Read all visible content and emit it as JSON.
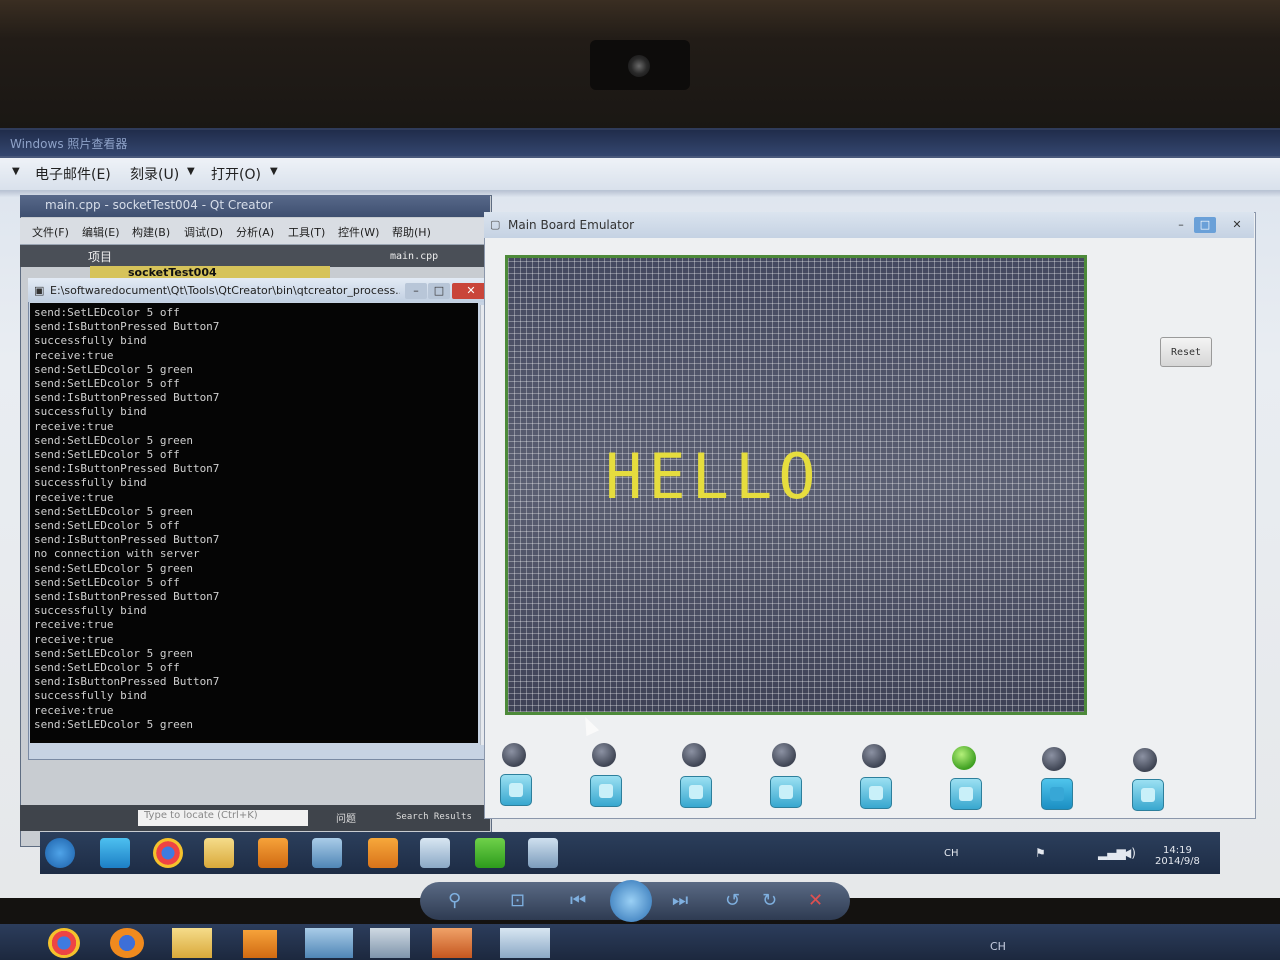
{
  "viewer": {
    "title": "Windows 照片查看器",
    "menu": [
      "电子邮件(E)",
      "刻录(U)",
      "打开(O)"
    ]
  },
  "qtcreator": {
    "title": "main.cpp - socketTest004 - Qt Creator",
    "menu": [
      "文件(F)",
      "编辑(E)",
      "构建(B)",
      "调试(D)",
      "分析(A)",
      "工具(T)",
      "控件(W)",
      "帮助(H)"
    ],
    "project_label": "项目",
    "open_file": "main.cpp",
    "tree_item": "socketTest004",
    "locate_placeholder": "Type to locate (Ctrl+K)",
    "tab_issues": "问题",
    "tab_search": "Search Results"
  },
  "console": {
    "title": "E:\\softwaredocument\\Qt\\Tools\\QtCreator\\bin\\qtcreator_process...",
    "lines": [
      "send:SetLEDcolor 5 off",
      "send:IsButtonPressed Button7",
      "successfully bind",
      "receive:true",
      "send:SetLEDcolor 5 green",
      "send:SetLEDcolor 5 off",
      "send:IsButtonPressed Button7",
      "successfully bind",
      "receive:true",
      "send:SetLEDcolor 5 green",
      "send:SetLEDcolor 5 off",
      "send:IsButtonPressed Button7",
      "successfully bind",
      "receive:true",
      "send:SetLEDcolor 5 green",
      "send:SetLEDcolor 5 off",
      "send:IsButtonPressed Button7",
      "no connection with server",
      "send:SetLEDcolor 5 green",
      "send:SetLEDcolor 5 off",
      "send:IsButtonPressed Button7",
      "successfully bind",
      "receive:true",
      "receive:true",
      "send:SetLEDcolor 5 green",
      "send:SetLEDcolor 5 off",
      "send:IsButtonPressed Button7",
      "successfully bind",
      "receive:true",
      "send:SetLEDcolor 5 green"
    ]
  },
  "emulator": {
    "title": "Main Board Emulator",
    "lcd_text": "HELLO",
    "lcd_text_color": "#e6dd3e",
    "reset_label": "Reset",
    "leds": [
      "off",
      "off",
      "off",
      "off",
      "off",
      "green",
      "off",
      "off"
    ],
    "buttons_pressed": [
      false,
      false,
      false,
      false,
      false,
      false,
      true,
      false
    ]
  },
  "taskbar": {
    "lang": "CH",
    "time": "14:19",
    "date": "2014/9/8"
  },
  "outer_taskbar": {
    "lang": "CH"
  },
  "colors": {
    "led_green": "#3fa022",
    "lcd_border": "#4d8a3a",
    "button_blue": "#38a7cf"
  }
}
